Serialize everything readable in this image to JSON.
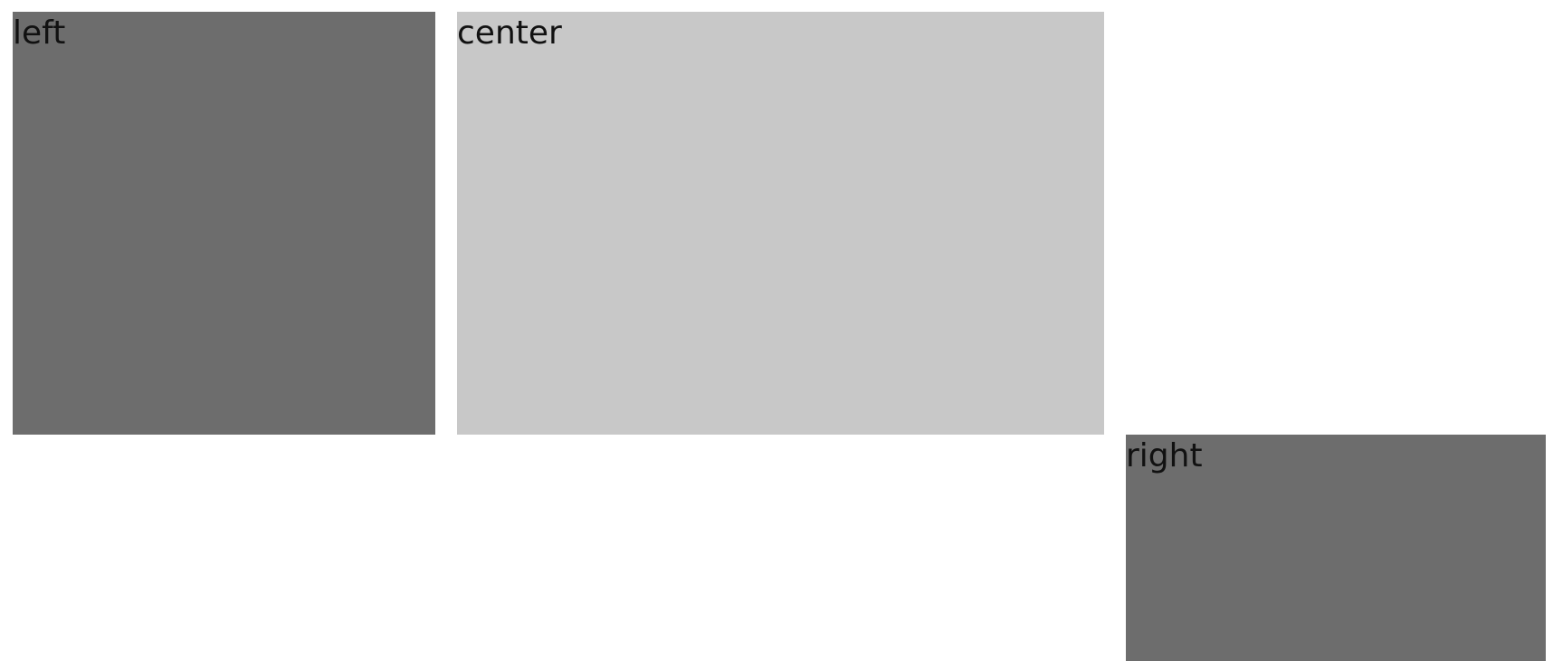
{
  "panels": {
    "left": {
      "label": "left",
      "color": "#6d6d6d"
    },
    "center": {
      "label": "center",
      "color": "#c8c8c8"
    },
    "right": {
      "label": "right",
      "color": "#6d6d6d"
    }
  }
}
